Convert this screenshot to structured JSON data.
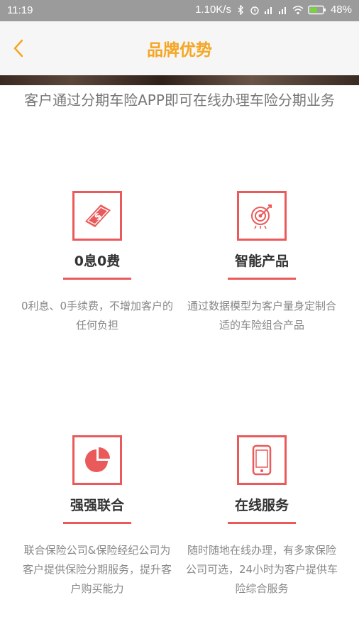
{
  "status_bar": {
    "time": "11:19",
    "speed": "1.10K/s",
    "battery": "48%",
    "icons": [
      "bluetooth-icon",
      "alarm-icon",
      "signal-icon",
      "signal-icon",
      "wifi-icon",
      "battery-icon"
    ]
  },
  "app_bar": {
    "title": "品牌优势",
    "back_icon": "chevron-left-icon",
    "accent": "#f5a623"
  },
  "intro": "客户通过分期车险APP即可在线办理车险分期业务",
  "features": [
    {
      "icon": "money-icon",
      "title": "0息0费",
      "desc": "0利息、0手续费，不增加客户的任何负担"
    },
    {
      "icon": "target-icon",
      "title": "智能产品",
      "desc": "通过数据模型为客户量身定制合适的车险组合产品"
    },
    {
      "icon": "pie-chart-icon",
      "title": "强强联合",
      "desc": "联合保险公司&保险经纪公司为客户提供保险分期服务，提升客户购买能力"
    },
    {
      "icon": "phone-icon",
      "title": "在线服务",
      "desc": "随时随地在线办理，有多家保险公司可选，24小时为客户提供车险综合服务"
    }
  ],
  "colors": {
    "accent_red": "#ea5a5a",
    "status_bar": "#9b9b9b"
  }
}
